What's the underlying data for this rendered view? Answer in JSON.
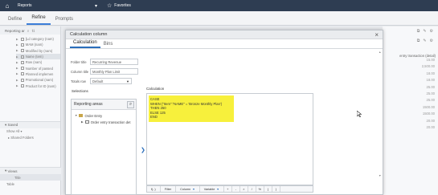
{
  "topbar": {
    "home_icon": "home-icon",
    "reports": "Reports",
    "favorites": "Favorites"
  },
  "tabs": [
    {
      "label": "Define"
    },
    {
      "label": "Refine"
    },
    {
      "label": "Prompts"
    }
  ],
  "left_panel": {
    "header": "Reporting ar",
    "items": [
      {
        "label": "[Ld category (nam)"
      },
      {
        "label": "MAM (nam)"
      },
      {
        "label": "Modified by (nam)"
      },
      {
        "label": "Name (tem)"
      },
      {
        "label": "Row (nam)"
      },
      {
        "label": "Number of passed"
      },
      {
        "label": "Planned implemen"
      },
      {
        "label": "Promotional (nam)"
      },
      {
        "label": "Product for ID (nam)"
      }
    ],
    "saved_label": "Saved",
    "show_label": "Show",
    "show_value": "All",
    "shared_label": "Shared Folders",
    "views_label": "Views",
    "title_label": "Title",
    "table_label": "Table"
  },
  "right_panel": {
    "header": "entry transaction (detail)",
    "numbers": [
      "15.00",
      "2,500.00",
      "18.00",
      "18.00",
      "25.00",
      "25.00",
      "25.00",
      "1500.00",
      "1500.00",
      "20.00",
      "20.00"
    ]
  },
  "modal": {
    "title": "Calculation column",
    "tabs": [
      {
        "label": "Calculation"
      },
      {
        "label": "Bins"
      }
    ],
    "folder_title_label": "Folder title",
    "folder_title_value": "Recurring Revenue",
    "column_title_label": "Column title",
    "column_title_value": "Monthly Plan Limit",
    "totals_row_label": "Totals row",
    "totals_row_value": "Default",
    "selections_label": "Selections",
    "reporting_areas_label": "Reporting areas",
    "tree": [
      {
        "label": "Order Entry"
      },
      {
        "label": "Order entry transaction det"
      }
    ],
    "calculation_label": "Calculation",
    "code_lines": [
      "CASE",
      "WHEN (\"Item\".\"NAME\" = 'Bronze Monthly Plan')",
      "THEN 250",
      "ELSE 125",
      "END"
    ],
    "toolbar": {
      "fx": "f(..)",
      "filter": "Filter",
      "column": "Column",
      "variable": "Variable",
      "ops": [
        "+",
        "-",
        "×",
        "/",
        "%",
        "(",
        ")"
      ]
    }
  }
}
